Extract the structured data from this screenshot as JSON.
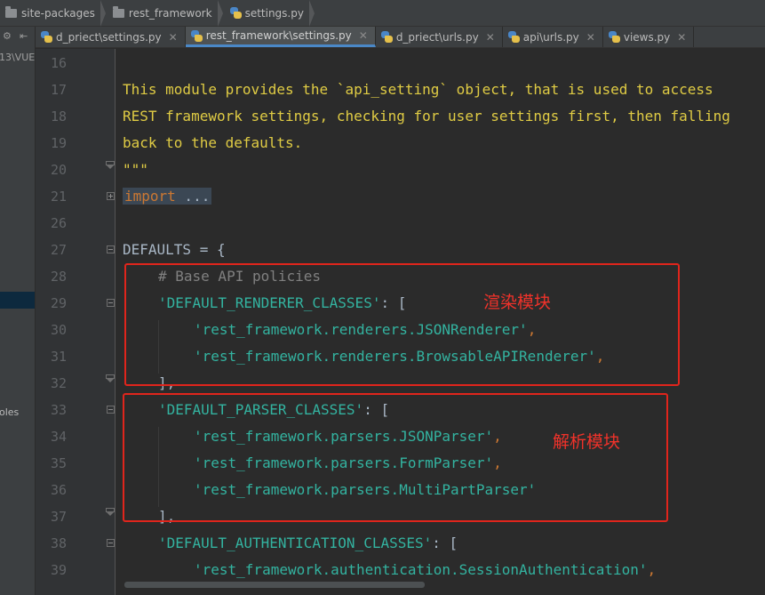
{
  "breadcrumb": [
    "site-packages",
    "rest_framework",
    "settings.py"
  ],
  "tabs": [
    {
      "label": "d_priect\\settings.py",
      "active": false
    },
    {
      "label": "rest_framework\\settings.py",
      "active": true
    },
    {
      "label": "d_priect\\urls.py",
      "active": false
    },
    {
      "label": "api\\urls.py",
      "active": false
    },
    {
      "label": "views.py",
      "active": false
    }
  ],
  "project_panel": {
    "path_fragment": "13\\VUE",
    "item_fragment": "oles"
  },
  "lines": [
    {
      "num": "16",
      "text": ""
    },
    {
      "num": "17",
      "text": "This module provides the `api_setting` object, that is used to access"
    },
    {
      "num": "18",
      "text": "REST framework settings, checking for user settings first, then falling"
    },
    {
      "num": "19",
      "text": "back to the defaults."
    },
    {
      "num": "20",
      "text": "\"\"\""
    },
    {
      "num": "21",
      "kw": "import",
      "rest": " ..."
    },
    {
      "num": "26",
      "text": ""
    },
    {
      "num": "27",
      "idn": "DEFAULTS",
      "rest": " = {"
    },
    {
      "num": "28",
      "comment": "# Base API policies"
    },
    {
      "num": "29",
      "key": "'DEFAULT_RENDERER_CLASSES'",
      "rest": ": ["
    },
    {
      "num": "30",
      "str": "'rest_framework.renderers.JSONRenderer'",
      "rest": ","
    },
    {
      "num": "31",
      "str": "'rest_framework.renderers.BrowsableAPIRenderer'",
      "rest": ","
    },
    {
      "num": "32",
      "rest": "],"
    },
    {
      "num": "33",
      "key": "'DEFAULT_PARSER_CLASSES'",
      "rest": ": ["
    },
    {
      "num": "34",
      "str": "'rest_framework.parsers.JSONParser'",
      "rest": ","
    },
    {
      "num": "35",
      "str": "'rest_framework.parsers.FormParser'",
      "rest": ","
    },
    {
      "num": "36",
      "str": "'rest_framework.parsers.MultiPartParser'",
      "rest": ""
    },
    {
      "num": "37",
      "rest": "],"
    },
    {
      "num": "38",
      "key": "'DEFAULT_AUTHENTICATION_CLASSES'",
      "rest": ": ["
    },
    {
      "num": "39",
      "str": "'rest_framework.authentication.SessionAuthentication'",
      "rest": ","
    }
  ],
  "annotations": {
    "renderer_label": "渲染模块",
    "parser_label": "解析模块"
  },
  "colors": {
    "annotation": "#e0251c",
    "string": "#33b3a0",
    "docstring": "#dfcb44",
    "keyword": "#cc7832"
  }
}
